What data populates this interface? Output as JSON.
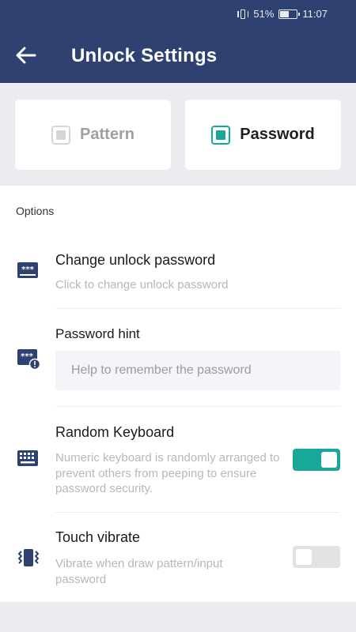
{
  "status_bar": {
    "battery_percent": "51%",
    "time": "11:07"
  },
  "header": {
    "title": "Unlock Settings"
  },
  "modes": [
    {
      "label": "Pattern",
      "selected": false
    },
    {
      "label": "Password",
      "selected": true
    }
  ],
  "options": {
    "section_title": "Options",
    "change_password": {
      "title": "Change unlock password",
      "desc": "Click to change unlock password"
    },
    "password_hint": {
      "title": "Password hint",
      "placeholder": "Help to remember the password",
      "value": ""
    },
    "random_keyboard": {
      "title": "Random Keyboard",
      "desc": "Numeric keyboard is randomly arranged to prevent others from peeping to ensure password security.",
      "enabled": true
    },
    "touch_vibrate": {
      "title": "Touch vibrate",
      "desc": "Vibrate when draw pattern/input password",
      "enabled": false
    }
  },
  "colors": {
    "header_bg": "#2e4171",
    "accent": "#17a89a",
    "icon": "#2e4171"
  },
  "icons": [
    "arrow-back",
    "password-field",
    "password-hint",
    "keyboard",
    "vibrate"
  ]
}
